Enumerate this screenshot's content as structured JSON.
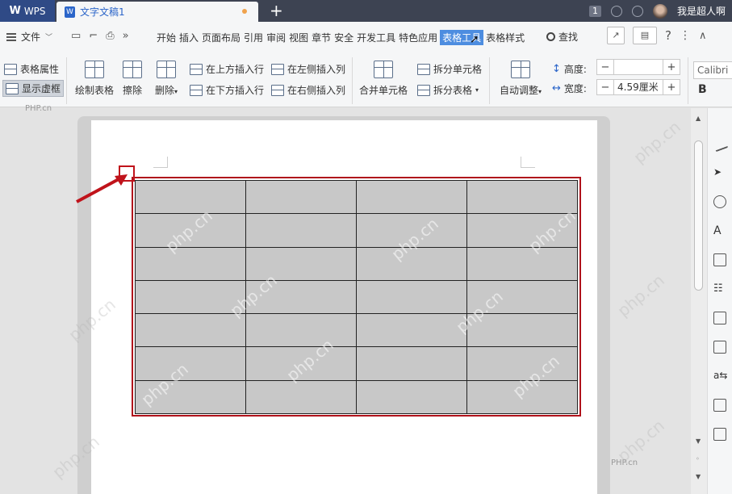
{
  "titlebar": {
    "app_name": "WPS",
    "doc_tab": "文字文稿1",
    "new_tab": "+",
    "badge": "1",
    "username": "我是超人啊"
  },
  "menubar": {
    "file": "文件",
    "tabs": [
      "开始",
      "插入",
      "页面布局",
      "引用",
      "审阅",
      "视图",
      "章节",
      "安全",
      "开发工具",
      "特色应用",
      "表格工具",
      "表格样式"
    ],
    "active_tab": "表格工具",
    "search": "查找",
    "help": "?",
    "more": "⋮",
    "collapse": "∧"
  },
  "ribbon": {
    "table_props": "表格属性",
    "show_gridlines": "显示虚框",
    "draw_table": "绘制表格",
    "eraser": "擦除",
    "delete": "删除",
    "insert_above": "在上方插入行",
    "insert_below": "在下方插入行",
    "insert_left": "在左侧插入列",
    "insert_right": "在右侧插入列",
    "merge_cells": "合并单元格",
    "split_cells": "拆分单元格",
    "split_table": "拆分表格",
    "auto_fit": "自动调整",
    "height_label": "高度:",
    "height_value": "",
    "width_label": "宽度:",
    "width_value": "4.59厘米",
    "minus": "−",
    "plus": "+",
    "font_name": "Calibri",
    "bold": "B"
  },
  "table": {
    "rows": 7,
    "cols": 4
  },
  "watermarks": {
    "text": "php.cn",
    "small_top": "PHP.cn",
    "small_bottom": "PHP.cn"
  },
  "colors": {
    "titlebar": "#3d4352",
    "accent": "#4d8de0",
    "highlight_border": "#b0121b",
    "cell_fill": "#c8c8c8"
  }
}
